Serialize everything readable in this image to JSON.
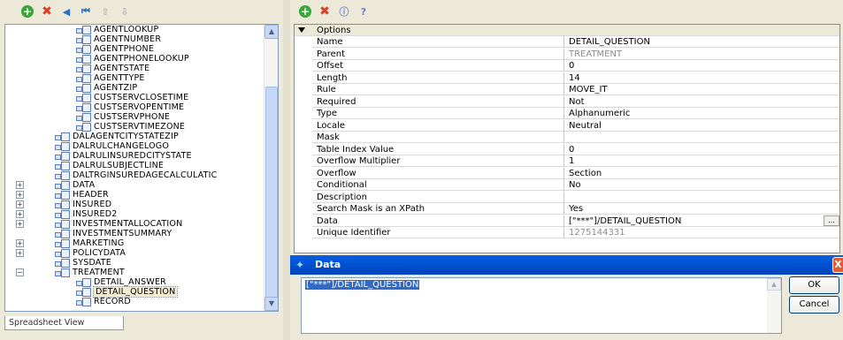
{
  "left_toolbar": {
    "icons": [
      "add-icon",
      "delete-icon",
      "previous-icon",
      "first-icon",
      "move-up-icon",
      "move-down-icon"
    ]
  },
  "tree": {
    "items": [
      {
        "label": "AGENTLOOKUP",
        "level": 2
      },
      {
        "label": "AGENTNUMBER",
        "level": 2
      },
      {
        "label": "AGENTPHONE",
        "level": 2
      },
      {
        "label": "AGENTPHONELOOKUP",
        "level": 2
      },
      {
        "label": "AGENTSTATE",
        "level": 2
      },
      {
        "label": "AGENTTYPE",
        "level": 2
      },
      {
        "label": "AGENTZIP",
        "level": 2
      },
      {
        "label": "CUSTSERVCLOSETIME",
        "level": 2
      },
      {
        "label": "CUSTSERVOPENTIME",
        "level": 2
      },
      {
        "label": "CUSTSERVPHONE",
        "level": 2
      },
      {
        "label": "CUSTSERVTIMEZONE",
        "level": 2
      },
      {
        "label": "DALAGENTCITYSTATEZIP",
        "level": 1
      },
      {
        "label": "DALRULCHANGELOGO",
        "level": 1
      },
      {
        "label": "DALRULINSUREDCITYSTATE",
        "level": 1
      },
      {
        "label": "DALRULSUBJECTLINE",
        "level": 1
      },
      {
        "label": "DALTRGINSUREDAGECALCULATIC",
        "level": 1
      },
      {
        "label": "DATA",
        "level": 1,
        "expander": "+"
      },
      {
        "label": "HEADER",
        "level": 1,
        "expander": "+"
      },
      {
        "label": "INSURED",
        "level": 1,
        "expander": "+"
      },
      {
        "label": "INSURED2",
        "level": 1,
        "expander": "+"
      },
      {
        "label": "INVESTMENTALLOCATION",
        "level": 1,
        "expander": "+"
      },
      {
        "label": "INVESTMENTSUMMARY",
        "level": 1
      },
      {
        "label": "MARKETING",
        "level": 1,
        "expander": "+"
      },
      {
        "label": "POLICYDATA",
        "level": 1,
        "expander": "+"
      },
      {
        "label": "SYSDATE",
        "level": 1
      },
      {
        "label": "TREATMENT",
        "level": 1,
        "expander": "−"
      },
      {
        "label": "DETAIL_ANSWER",
        "level": 2
      },
      {
        "label": "DETAIL_QUESTION",
        "level": 2,
        "selected": true
      },
      {
        "label": "RECORD",
        "level": 2
      }
    ]
  },
  "bottom_tab": {
    "label": "Spreadsheet View"
  },
  "right_toolbar": {
    "icons": [
      "add-icon",
      "delete-icon",
      "info-icon",
      "help-icon"
    ]
  },
  "properties": {
    "section": "Options",
    "rows": [
      {
        "name": "Name",
        "value": "DETAIL_QUESTION"
      },
      {
        "name": "Parent",
        "value": "TREATMENT",
        "gray": true
      },
      {
        "name": "Offset",
        "value": "0"
      },
      {
        "name": "Length",
        "value": "14"
      },
      {
        "name": "Rule",
        "value": "MOVE_IT"
      },
      {
        "name": "Required",
        "value": "Not"
      },
      {
        "name": "Type",
        "value": "Alphanumeric"
      },
      {
        "name": "Locale",
        "value": "Neutral"
      },
      {
        "name": "Mask",
        "value": ""
      },
      {
        "name": "Table Index Value",
        "value": "0"
      },
      {
        "name": "Overflow Multiplier",
        "value": "1"
      },
      {
        "name": "Overflow",
        "value": "Section"
      },
      {
        "name": "Conditional",
        "value": "No"
      },
      {
        "name": "Description",
        "value": ""
      },
      {
        "name": "Search Mask is an XPath",
        "value": "Yes"
      },
      {
        "name": "Data",
        "value": "[\"***\"]/DETAIL_QUESTION",
        "has_button": true
      },
      {
        "name": "Unique Identifier",
        "value": "1275144331",
        "gray": true
      }
    ],
    "ellipsis_label": "..."
  },
  "dialog": {
    "title": "Data",
    "text": "[\"***\"]/DETAIL_QUESTION",
    "ok_label": "OK",
    "cancel_label": "Cancel",
    "close_glyph": "X"
  }
}
